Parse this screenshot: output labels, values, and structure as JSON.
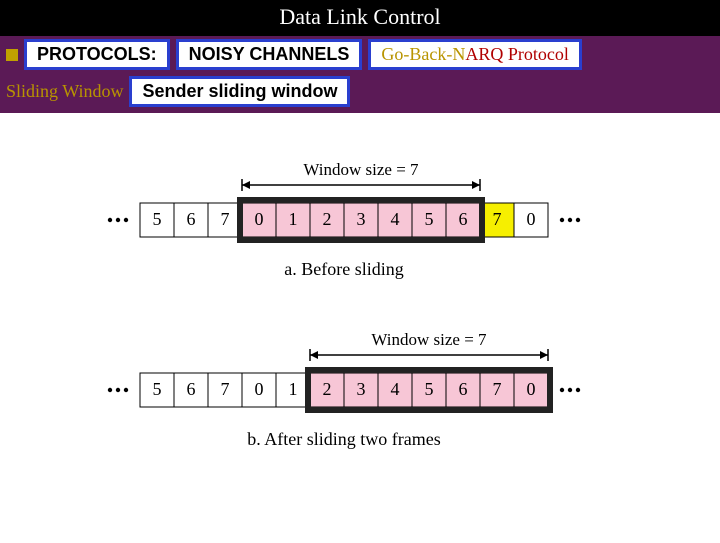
{
  "header": {
    "title": "Data Link Control",
    "protocols_label": "PROTOCOLS:",
    "noisy_label": "NOISY CHANNELS",
    "gbn_label_1": "Go-Back-N ",
    "gbn_label_2": "ARQ Protocol",
    "sliding_window_label": "Sliding Window",
    "sender_sw_label": "Sender sliding window"
  },
  "chart_data": [
    {
      "type": "table",
      "title": "a. Before sliding",
      "window_label": "Window size = 7",
      "cells": [
        {
          "v": "5",
          "state": "ack"
        },
        {
          "v": "6",
          "state": "ack"
        },
        {
          "v": "7",
          "state": "ack"
        },
        {
          "v": "0",
          "state": "win"
        },
        {
          "v": "1",
          "state": "win"
        },
        {
          "v": "2",
          "state": "win"
        },
        {
          "v": "3",
          "state": "win"
        },
        {
          "v": "4",
          "state": "win"
        },
        {
          "v": "5",
          "state": "win"
        },
        {
          "v": "6",
          "state": "win"
        },
        {
          "v": "7",
          "state": "next"
        },
        {
          "v": "0",
          "state": "future"
        }
      ],
      "window_start_index": 3,
      "window_end_index": 9
    },
    {
      "type": "table",
      "title": "b. After sliding two frames",
      "window_label": "Window size = 7",
      "cells": [
        {
          "v": "5",
          "state": "ack"
        },
        {
          "v": "6",
          "state": "ack"
        },
        {
          "v": "7",
          "state": "ack"
        },
        {
          "v": "0",
          "state": "ack"
        },
        {
          "v": "1",
          "state": "ack"
        },
        {
          "v": "2",
          "state": "win"
        },
        {
          "v": "3",
          "state": "win"
        },
        {
          "v": "4",
          "state": "win"
        },
        {
          "v": "5",
          "state": "win"
        },
        {
          "v": "6",
          "state": "win"
        },
        {
          "v": "7",
          "state": "win"
        },
        {
          "v": "0",
          "state": "win"
        }
      ],
      "window_start_index": 5,
      "window_end_index": 11
    }
  ]
}
